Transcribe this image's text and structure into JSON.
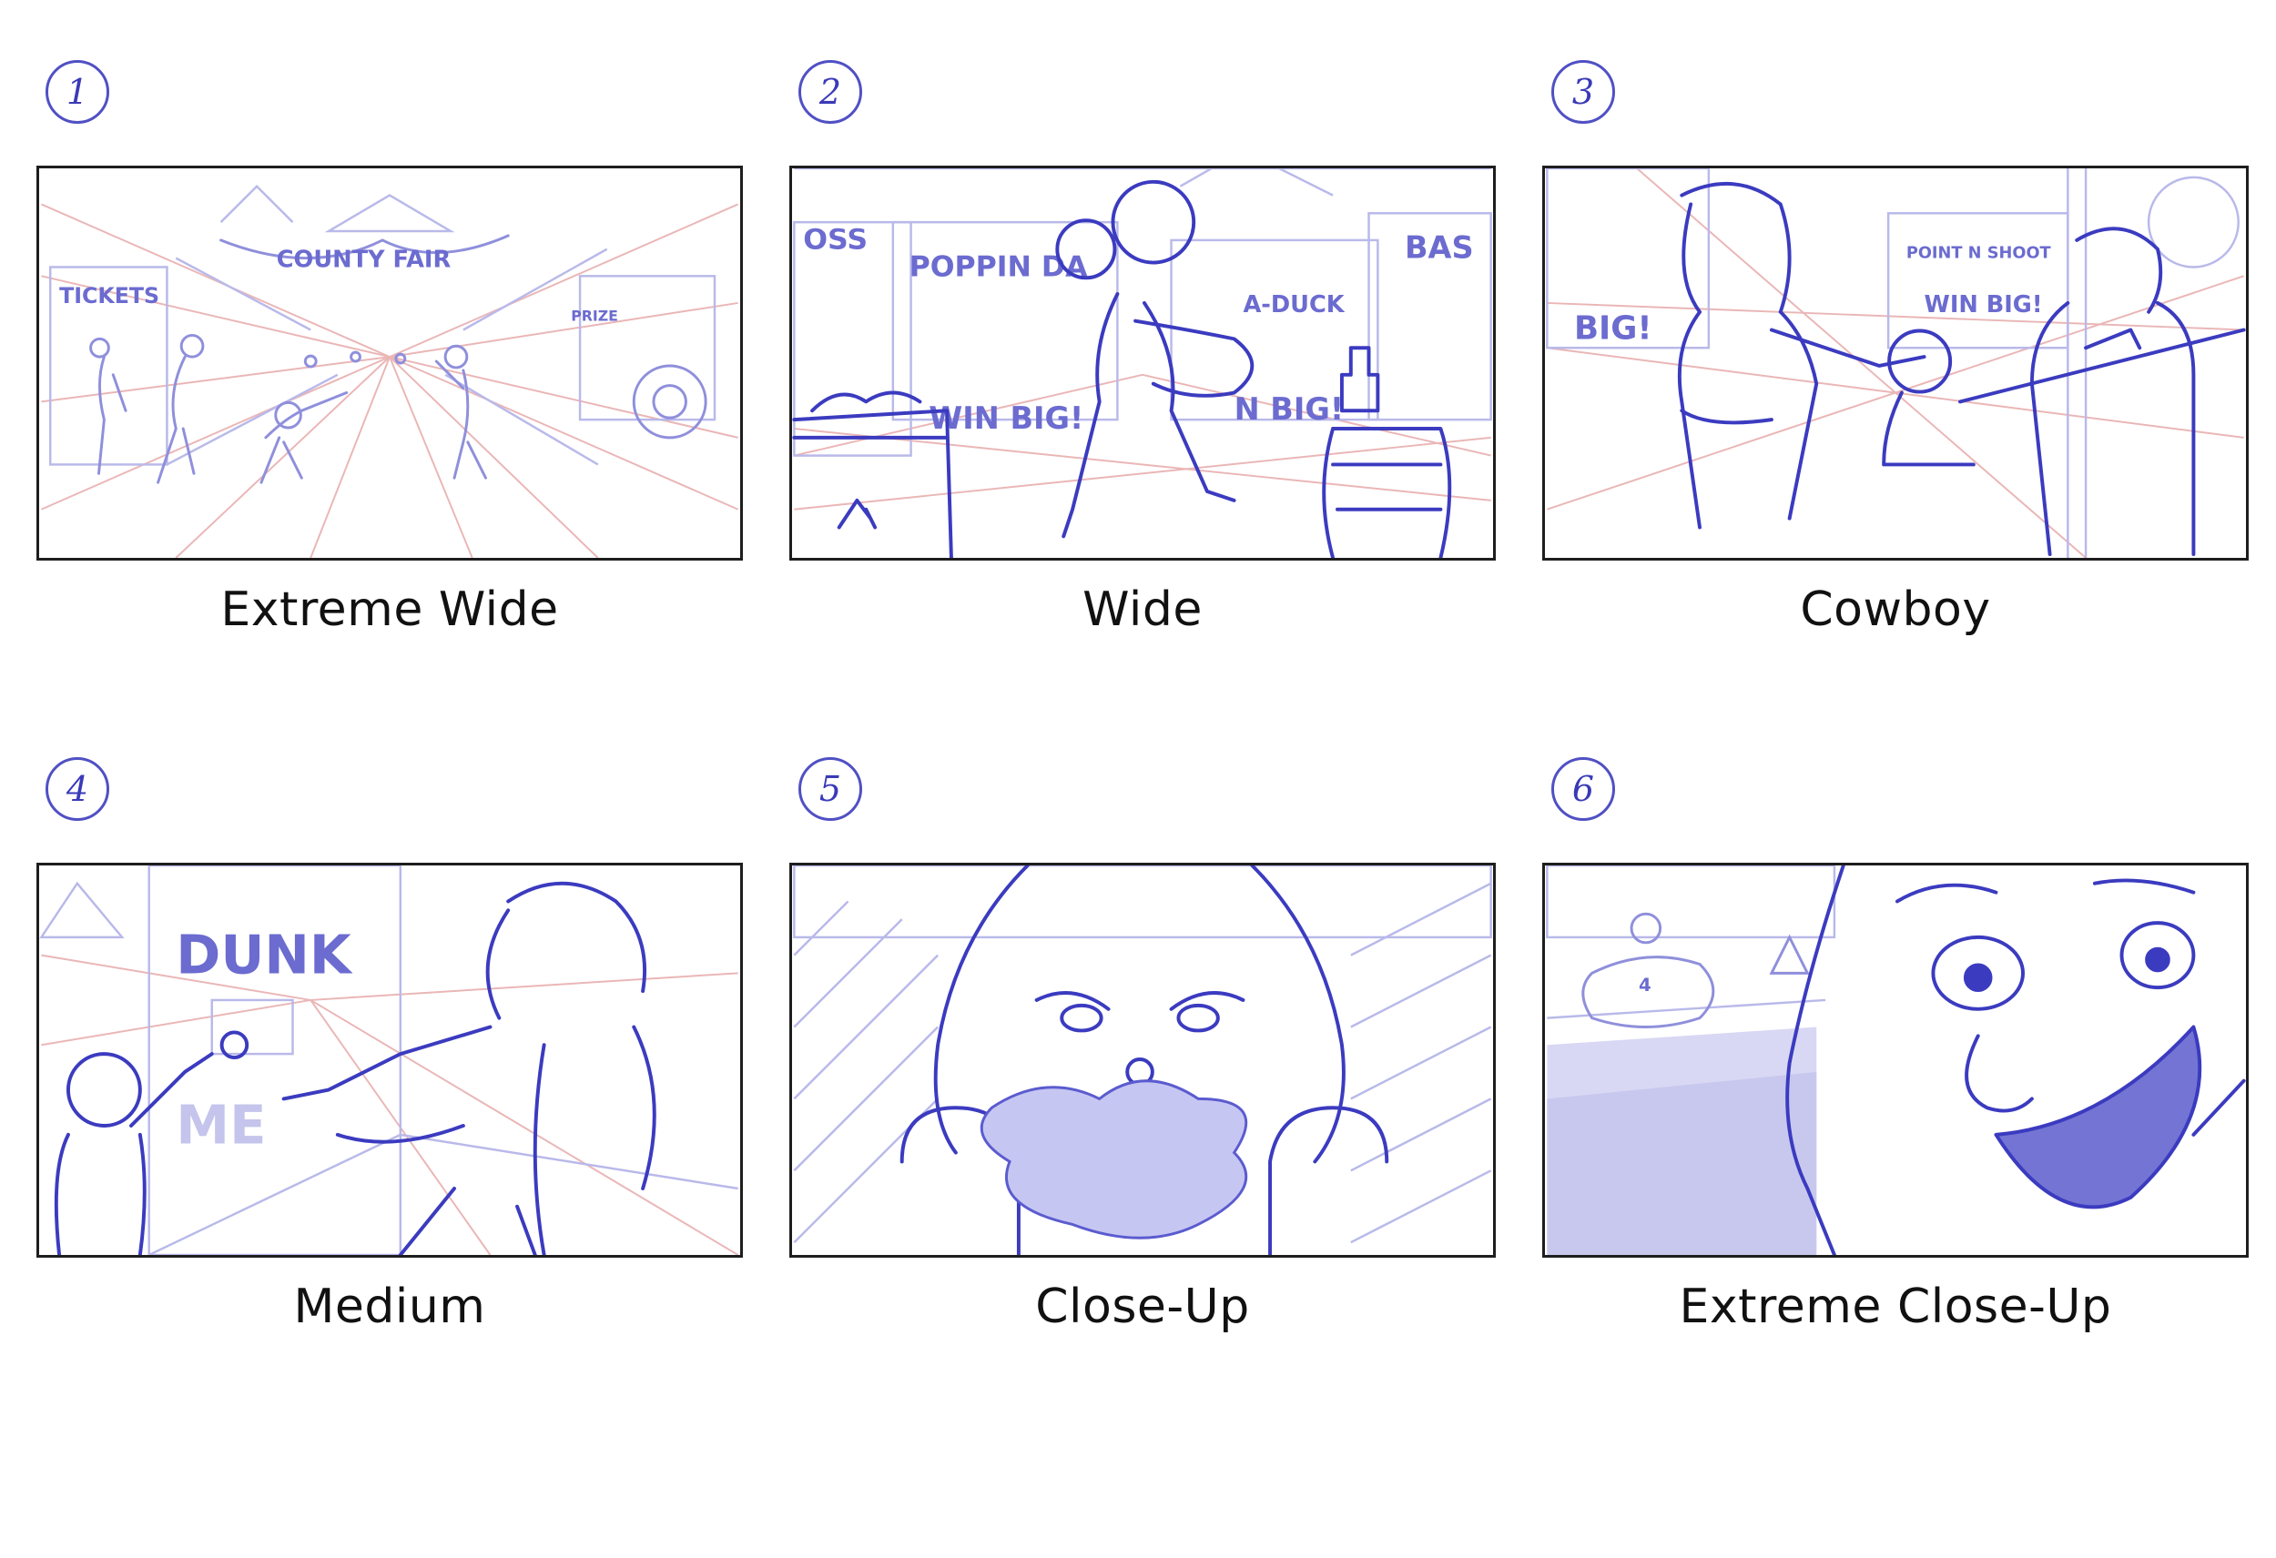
{
  "panels": [
    {
      "number": "1",
      "caption": "Extreme Wide",
      "sign_texts": {
        "tickets": "TICKETS",
        "banner": "COUNTY FAIR",
        "prize": "PRIZE"
      }
    },
    {
      "number": "2",
      "caption": "Wide",
      "sign_texts": {
        "left": "OSS",
        "poppin": "POPPIN DA",
        "duck": "A-DUCK",
        "bas": "BAS",
        "win1": "WIN BIG!",
        "win2": "N BIG!"
      }
    },
    {
      "number": "3",
      "caption": "Cowboy",
      "sign_texts": {
        "big": "BIG!",
        "shoot": "POINT N SHOOT",
        "winbig": "WIN BIG!"
      }
    },
    {
      "number": "4",
      "caption": "Medium",
      "sign_texts": {
        "dunk": "DUNK",
        "me": "ME"
      }
    },
    {
      "number": "5",
      "caption": "Close-Up"
    },
    {
      "number": "6",
      "caption": "Extreme Close-Up",
      "sign_texts": {
        "kart": "4"
      }
    }
  ],
  "colors": {
    "sketch": "#3b3bc0",
    "construction_lines": "#e6a5a5",
    "frame": "#1e1e1e"
  }
}
